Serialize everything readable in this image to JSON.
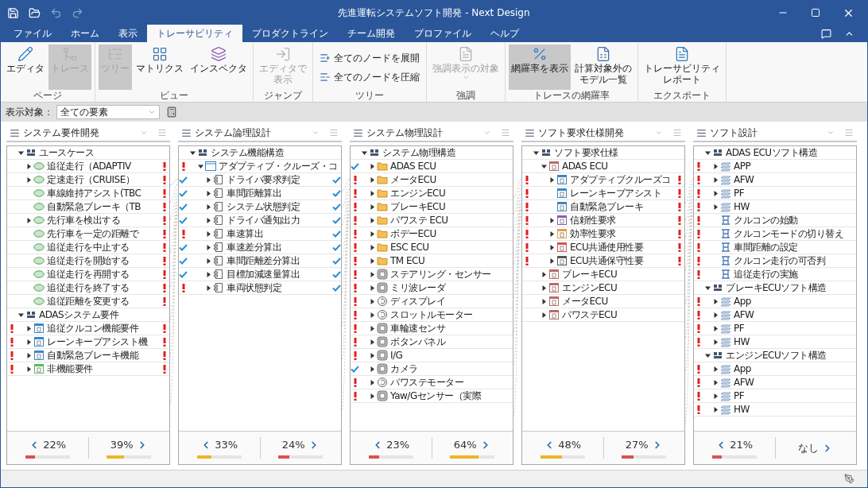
{
  "window": {
    "title": "先進運転システムソフト開発 - Next Design"
  },
  "quick_access": [
    {
      "disabled": false
    },
    {
      "disabled": false
    },
    {
      "disabled": true
    },
    {
      "disabled": true
    }
  ],
  "tabs": [
    {
      "label": "ファイル",
      "selected": false
    },
    {
      "label": "ホーム",
      "selected": false
    },
    {
      "label": "表示",
      "selected": false
    },
    {
      "label": "トレーサビリティ",
      "selected": true
    },
    {
      "label": "プロダクトライン",
      "selected": false
    },
    {
      "label": "チーム開発",
      "selected": false
    },
    {
      "label": "プロファイル",
      "selected": false
    },
    {
      "label": "ヘルプ",
      "selected": false
    }
  ],
  "ribbon": {
    "groups": [
      {
        "label": "ページ",
        "buttons": [
          {
            "label": "エディタ",
            "kind": "large",
            "disabled": false,
            "selected": false
          },
          {
            "label": "トレース",
            "kind": "large",
            "disabled": true,
            "selected": true
          }
        ]
      },
      {
        "label": "ビュー",
        "buttons": [
          {
            "label": "ツリー",
            "kind": "large",
            "disabled": true,
            "selected": true
          },
          {
            "label": "マトリクス",
            "kind": "large",
            "disabled": false,
            "selected": false
          },
          {
            "label": "インスペクタ",
            "kind": "large",
            "disabled": false,
            "selected": false
          }
        ]
      },
      {
        "label": "ジャンプ",
        "buttons": [
          {
            "lines": [
              "エディタで",
              "表示"
            ],
            "kind": "large",
            "disabled": true,
            "selected": false
          }
        ]
      },
      {
        "label": "ツリー",
        "buttons": [
          {
            "label": "全てのノードを展開",
            "kind": "small",
            "disabled": false,
            "selected": false
          },
          {
            "label": "全てのノードを圧縮",
            "kind": "small",
            "disabled": false,
            "selected": false
          }
        ]
      },
      {
        "label": "強調",
        "buttons": [
          {
            "label": "強調表示の対象",
            "kind": "dropdown",
            "disabled": true,
            "selected": false
          }
        ]
      },
      {
        "label": "トレースの網羅率",
        "buttons": [
          {
            "label": "網羅率を表示",
            "kind": "large",
            "disabled": false,
            "selected": true
          },
          {
            "lines": [
              "計算対象外の",
              "モデル一覧"
            ],
            "kind": "large",
            "disabled": false,
            "selected": false
          }
        ]
      },
      {
        "label": "エクスポート",
        "buttons": [
          {
            "lines": [
              "トレーサビリティ",
              "レポート"
            ],
            "kind": "large",
            "disabled": false,
            "selected": false
          }
        ]
      }
    ]
  },
  "filter": {
    "label": "表示対象：",
    "value": "全ての要素"
  },
  "panels": [
    {
      "title": "システム要件開発",
      "tree": [
        {
          "label": "ユースケース",
          "kind": "package",
          "expanded": true,
          "children": [
            {
              "label": "追従走行（ADAPTIV",
              "kind": "usecase",
              "expanded": false,
              "right_error": true
            },
            {
              "label": "定速走行（CRUISE）",
              "kind": "usecase",
              "expanded": false,
              "right_error": true
            },
            {
              "label": "車線維持アシスト(TBC",
              "kind": "usecase",
              "right_error": true
            },
            {
              "label": "自動緊急ブレーキ（TB",
              "kind": "usecase",
              "right_error": true
            },
            {
              "label": "先行車を検出する",
              "kind": "usecase",
              "expanded": false,
              "right_error": true
            },
            {
              "label": "先行車を一定の距離で",
              "kind": "usecase",
              "right_error": true
            },
            {
              "label": "追従走行を中止する",
              "kind": "usecase",
              "right_error": true
            },
            {
              "label": "追従走行を開始する",
              "kind": "usecase",
              "right_error": true
            },
            {
              "label": "追従走行を再開する",
              "kind": "usecase",
              "right_error": true
            },
            {
              "label": "追従走行を終了する",
              "kind": "usecase",
              "right_error": true
            },
            {
              "label": "追従距離を変更する",
              "kind": "usecase",
              "right_error": true
            }
          ]
        },
        {
          "label": "ADASシステム要件",
          "kind": "package",
          "expanded": true,
          "children": [
            {
              "label": "追従クルコン機能要件",
              "kind": "requirement",
              "color": "#3a87c8",
              "expanded": false,
              "left_error": true,
              "right_error": true
            },
            {
              "label": "レーンキープアシスト機",
              "kind": "requirement",
              "color": "#3a87c8",
              "expanded": false,
              "left_error": true,
              "right_error": true
            },
            {
              "label": "自動緊急ブレーキ機能",
              "kind": "requirement",
              "color": "#3a87c8",
              "expanded": false,
              "left_error": true,
              "right_error": true
            },
            {
              "label": "非機能要件",
              "kind": "requirement",
              "color": "#5cb85c",
              "expanded": false,
              "left_error": true,
              "right_error": true
            }
          ]
        }
      ],
      "coverage": [
        {
          "value": "22%",
          "level": 0.22,
          "color": "#d9534f"
        },
        {
          "value": "39%",
          "level": 0.39,
          "color": "#f0b429"
        }
      ]
    },
    {
      "title": "システム論理設計",
      "tree": [
        {
          "label": "システム機能構造",
          "kind": "package",
          "expanded": true,
          "children": [
            {
              "label": "アダプティブ・クルーズ・コ",
              "kind": "block",
              "expanded": true,
              "left_error": true,
              "children": [
                {
                  "label": "ドライバ要求判定",
                  "kind": "function",
                  "expanded": false,
                  "left_check": true,
                  "right_check": true
                },
                {
                  "label": "車間距離算出",
                  "kind": "function",
                  "expanded": false,
                  "left_check": true,
                  "right_check": true
                },
                {
                  "label": "システム状態判定",
                  "kind": "function",
                  "expanded": false,
                  "left_check": true,
                  "right_check": true
                },
                {
                  "label": "ドライバ通知出力",
                  "kind": "function",
                  "expanded": false,
                  "left_check": true,
                  "right_check": true
                },
                {
                  "label": "車速算出",
                  "kind": "function",
                  "expanded": false,
                  "left_error": true,
                  "right_check": true
                },
                {
                  "label": "車速差分算出",
                  "kind": "function",
                  "expanded": false,
                  "left_check": true,
                  "right_check": true
                },
                {
                  "label": "車間距離差分算出",
                  "kind": "function",
                  "expanded": false,
                  "left_check": true,
                  "right_check": true
                },
                {
                  "label": "目標加減速量算出",
                  "kind": "function",
                  "expanded": false,
                  "left_check": true,
                  "right_check": true
                },
                {
                  "label": "車両状態判定",
                  "kind": "function",
                  "expanded": false,
                  "left_error": true,
                  "right_check": true
                }
              ]
            }
          ]
        }
      ],
      "coverage": [
        {
          "value": "33%",
          "level": 0.33,
          "color": "#f0b429"
        },
        {
          "value": "24%",
          "level": 0.24,
          "color": "#d9534f"
        }
      ]
    },
    {
      "title": "システム物理設計",
      "tree": [
        {
          "label": "システム物理構造",
          "kind": "package",
          "expanded": true,
          "children": [
            {
              "label": "ADAS ECU",
              "kind": "folder",
              "expanded": false,
              "left_check": true
            },
            {
              "label": "メータECU",
              "kind": "folder",
              "expanded": false,
              "left_error": true
            },
            {
              "label": "エンジンECU",
              "kind": "folder",
              "expanded": false,
              "left_error": true
            },
            {
              "label": "ブレーキECU",
              "kind": "folder",
              "expanded": false,
              "left_error": true
            },
            {
              "label": "パワステ ECU",
              "kind": "folder",
              "expanded": false,
              "left_error": true
            },
            {
              "label": "ボデーECU",
              "kind": "folder",
              "expanded": false,
              "left_error": true
            },
            {
              "label": "ESC ECU",
              "kind": "folder",
              "expanded": false,
              "left_error": true
            },
            {
              "label": "TM ECU",
              "kind": "folder",
              "expanded": false,
              "left_error": true
            },
            {
              "label": "ステアリング・センサー",
              "kind": "device",
              "expanded": false,
              "left_error": true
            },
            {
              "label": "ミリ波レーダ",
              "kind": "device",
              "expanded": false,
              "left_error": true
            },
            {
              "label": "ディスプレイ",
              "kind": "motor",
              "expanded": false,
              "left_error": true
            },
            {
              "label": "スロットルモーター",
              "kind": "motor",
              "expanded": false,
              "left_error": true
            },
            {
              "label": "車輪速センサ",
              "kind": "device",
              "expanded": false,
              "left_error": true
            },
            {
              "label": "ボタンパネル",
              "kind": "device",
              "expanded": false,
              "left_error": true
            },
            {
              "label": "I/G",
              "kind": "device",
              "expanded": false,
              "left_error": true
            },
            {
              "label": "カメラ",
              "kind": "device",
              "expanded": false,
              "left_check": true
            },
            {
              "label": "パワステモーター",
              "kind": "motor",
              "expanded": false,
              "left_error": true
            },
            {
              "label": "Yaw/Gセンサー（実際",
              "kind": "device",
              "expanded": false,
              "left_error": true
            }
          ]
        }
      ],
      "coverage": [
        {
          "value": "23%",
          "level": 0.23,
          "color": "#d9534f"
        },
        {
          "value": "64%",
          "level": 0.64,
          "color": "#f0b429"
        }
      ]
    },
    {
      "title": "ソフト要求仕様開発",
      "tree": [
        {
          "label": "ソフト要求仕様",
          "kind": "package",
          "expanded": true,
          "children": [
            {
              "label": "ADAS ECU",
              "kind": "requirement",
              "color": "#b86b6b",
              "expanded": true,
              "children": [
                {
                  "label": "アダプティブクルーズコ",
                  "kind": "requirement",
                  "color": "#3a87c8",
                  "expanded": false,
                  "left_error": true,
                  "right_error": true
                },
                {
                  "label": "レーンキープアシスト",
                  "kind": "requirement",
                  "color": "#3a87c8",
                  "left_error": true,
                  "right_error": true
                },
                {
                  "label": "自動緊急ブレーキ",
                  "kind": "requirement",
                  "color": "#3a87c8",
                  "left_error": true,
                  "right_error": true
                },
                {
                  "label": "信頼性要求",
                  "kind": "requirement",
                  "color": "#8e5bb5",
                  "expanded": false,
                  "left_error": true,
                  "right_error": true
                },
                {
                  "label": "効率性要求",
                  "kind": "requirement",
                  "color": "#e8a040",
                  "expanded": false,
                  "left_error": true,
                  "right_error": true
                },
                {
                  "label": "ECU共通使用性要",
                  "kind": "requirement",
                  "color": "#d9534f",
                  "expanded": false,
                  "left_error": true,
                  "right_error": true
                },
                {
                  "label": "ECU共通保守性要",
                  "kind": "requirement",
                  "color": "#555555",
                  "expanded": false,
                  "left_error": true,
                  "right_error": true
                }
              ]
            },
            {
              "label": "ブレーキECU",
              "kind": "requirement",
              "color": "#b86b6b",
              "expanded": false
            },
            {
              "label": "エンジンECU",
              "kind": "requirement",
              "color": "#b86b6b",
              "expanded": false
            },
            {
              "label": "メータECU",
              "kind": "requirement",
              "color": "#b86b6b",
              "expanded": false
            },
            {
              "label": "パワステECU",
              "kind": "requirement",
              "color": "#b86b6b",
              "expanded": false
            }
          ]
        }
      ],
      "coverage": [
        {
          "value": "48%",
          "level": 0.48,
          "color": "#f0b429"
        },
        {
          "value": "27%",
          "level": 0.27,
          "color": "#d9534f"
        }
      ]
    },
    {
      "title": "ソフト設計",
      "tree": [
        {
          "label": "ADAS ECUソフト構造",
          "kind": "package",
          "expanded": true,
          "children": [
            {
              "label": "APP",
              "kind": "layer",
              "expanded": false,
              "left_error": true
            },
            {
              "label": "AFW",
              "kind": "layer",
              "expanded": false,
              "left_error": true
            },
            {
              "label": "PF",
              "kind": "layer",
              "expanded": false,
              "left_error": true
            },
            {
              "label": "HW",
              "kind": "layer",
              "expanded": false,
              "left_error": true
            },
            {
              "label": "クルコンの始動",
              "kind": "sequence",
              "left_error": true
            },
            {
              "label": "クルコンモードの切り替え",
              "kind": "sequence",
              "left_error": true
            },
            {
              "label": "車間距離の設定",
              "kind": "sequence",
              "left_error": true
            },
            {
              "label": "クルコン走行の可否判",
              "kind": "sequence",
              "left_error": true
            },
            {
              "label": "追従走行の実施",
              "kind": "sequence",
              "left_error": true
            }
          ]
        },
        {
          "label": "ブレーキECUソフト構造",
          "kind": "package",
          "expanded": true,
          "children": [
            {
              "label": "App",
              "kind": "layer",
              "expanded": false,
              "left_error": true
            },
            {
              "label": "AFW",
              "kind": "layer",
              "expanded": false,
              "left_error": true
            },
            {
              "label": "PF",
              "kind": "layer",
              "expanded": false,
              "left_error": true
            },
            {
              "label": "HW",
              "kind": "layer",
              "expanded": false,
              "left_error": true
            }
          ]
        },
        {
          "label": "エンジンECUソフト構造",
          "kind": "package",
          "expanded": true,
          "children": [
            {
              "label": "App",
              "kind": "layer",
              "expanded": false,
              "left_error": true
            },
            {
              "label": "AFW",
              "kind": "layer",
              "expanded": false,
              "left_error": true
            },
            {
              "label": "PF",
              "kind": "layer",
              "expanded": false,
              "left_error": true
            },
            {
              "label": "HW",
              "kind": "layer",
              "expanded": false,
              "left_error": true
            }
          ]
        }
      ],
      "coverage": [
        {
          "value": "21%",
          "level": 0.21,
          "color": "#d9534f"
        },
        {
          "value": "なし"
        }
      ]
    }
  ]
}
